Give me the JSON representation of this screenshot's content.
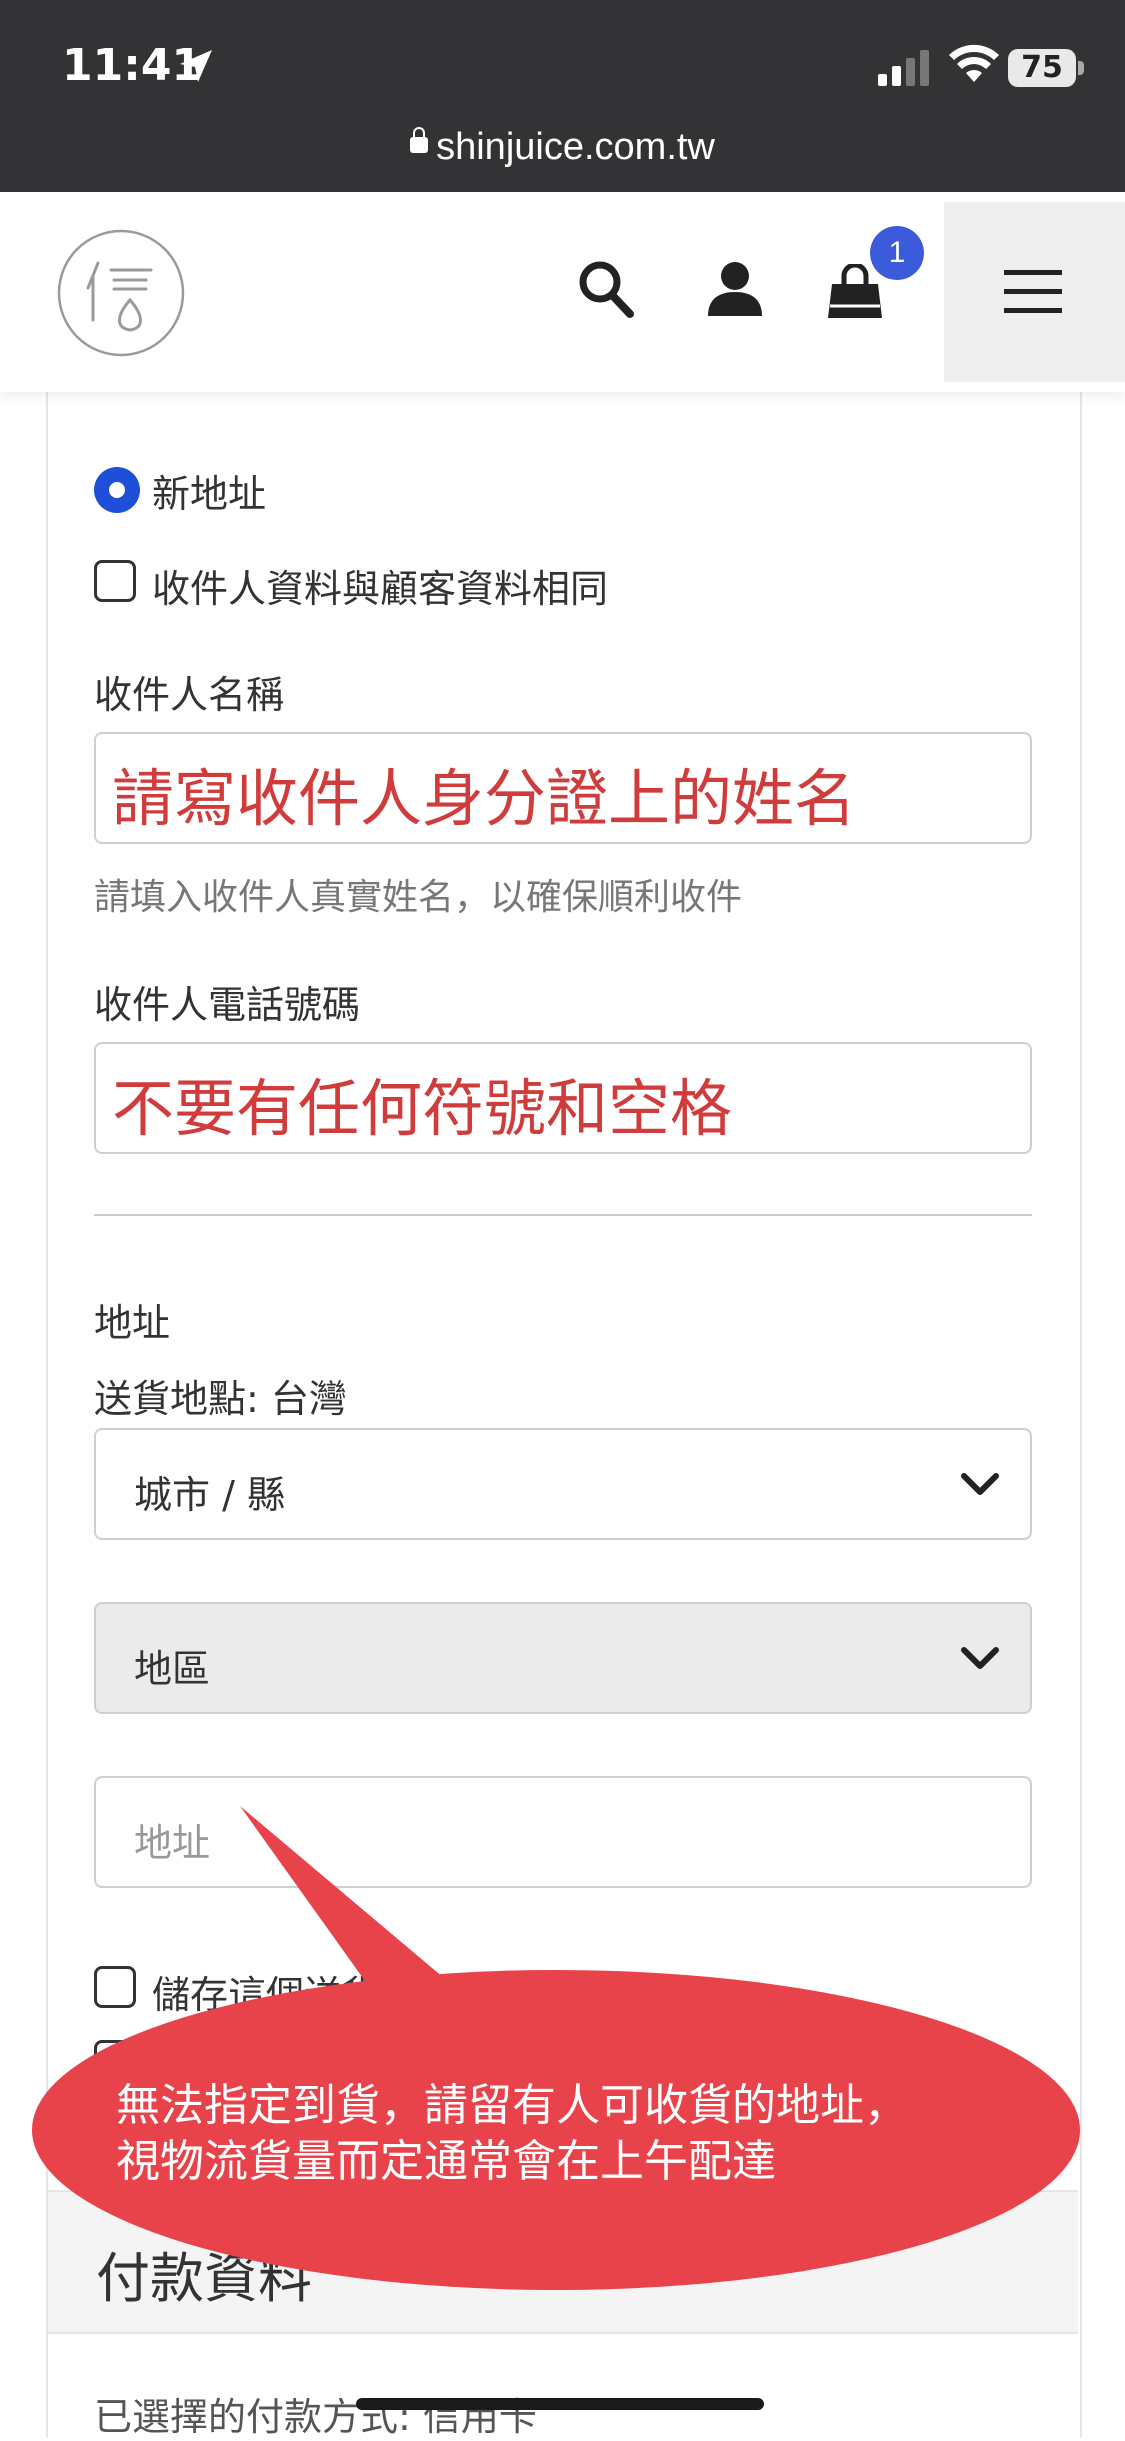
{
  "status_bar": {
    "time": "11:41",
    "battery": "75",
    "url": "shinjuice.com.tw"
  },
  "header": {
    "logo_alt": "信",
    "cart_count": "1"
  },
  "form": {
    "radio_new_address": "新地址",
    "checkbox_same_as_customer": "收件人資料與顧客資料相同",
    "recipient_name_label": "收件人名稱",
    "recipient_name_value": "請寫收件人身分證上的姓名",
    "recipient_name_helper": "請填入收件人真實姓名，以確保順利收件",
    "recipient_phone_label": "收件人電話號碼",
    "recipient_phone_value": "不要有任何符號和空格",
    "address_label": "地址",
    "delivery_location": "送貨地點: 台灣",
    "city_select": "城市 / 縣",
    "district_select": "地區",
    "address_placeholder": "地址",
    "save_address_checkbox": "儲存這個送貨地址"
  },
  "callout": {
    "line1": "無法指定到貨，請留有人可收貨的地址，",
    "line2": "視物流貨量而定通常會在上午配達"
  },
  "payment": {
    "section_title": "付款資料",
    "selected_method": "已選擇的付款方式: 信用卡"
  },
  "colors": {
    "accent_blue": "#1f4ed8",
    "callout_red": "#e8434a",
    "annotation_red": "#d03c3c",
    "status_bar_bg": "#333335"
  }
}
